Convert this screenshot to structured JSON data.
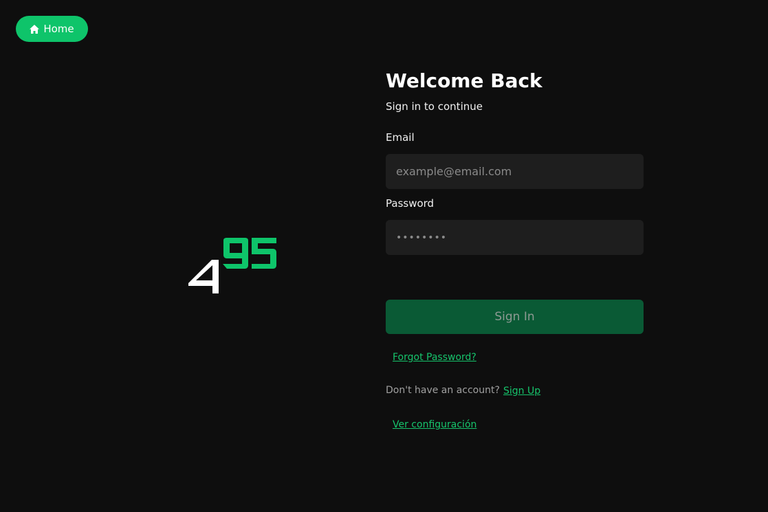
{
  "nav": {
    "home_label": "Home",
    "home_icon": "home-icon"
  },
  "logo": {
    "text_white": "4",
    "text_green": "95",
    "green_color": "#0ec46a"
  },
  "login": {
    "title": "Welcome Back",
    "subtitle": "Sign in to continue",
    "email_label": "Email",
    "email_placeholder": "example@email.com",
    "email_value": "",
    "password_label": "Password",
    "password_value": "••••••••",
    "signin_label": "Sign In",
    "forgot_label": "Forgot Password?",
    "no_account_text": "Don't have an account?",
    "signup_label": "Sign Up",
    "config_label": "Ver configuración"
  },
  "colors": {
    "background": "#0e0e0e",
    "accent": "#0ec46a",
    "button_disabled": "#0a5a35",
    "input_bg": "#1e1e1e",
    "link": "#16c46c"
  }
}
